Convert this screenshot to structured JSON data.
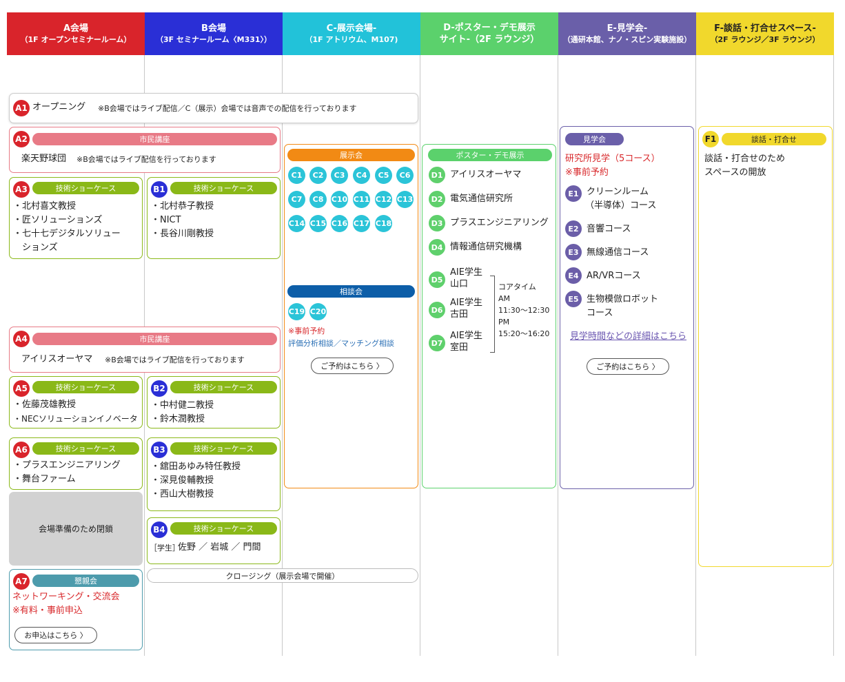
{
  "colors": {
    "A": "#d9242b",
    "B": "#2a2fd6",
    "C": "#22c2d9",
    "D": "#5bd16c",
    "E": "#6a5fa9",
    "F": "#f1d82c",
    "showcase": "#8ab818",
    "lecture": "#e87a86",
    "reception": "#4d9bac",
    "expo": "#f28a14",
    "consult": "#0d5ea8"
  },
  "headers": [
    {
      "line1": "A会場",
      "line2": "（1F オープンセミナールーム）"
    },
    {
      "line1": "B会場",
      "line2": "（3F セミナールーム〈M331〉）"
    },
    {
      "line1": "C-展示会場-",
      "line2": "（1F アトリウム、M107)"
    },
    {
      "line1": "D-ポスター・デモ展示",
      "line2": "サイト-（2F ラウンジ）"
    },
    {
      "line1": "E-見学会-",
      "line2": "（通研本館、ナノ・スピン実験施設）"
    },
    {
      "line1": "F-談話・打合せスペース-",
      "line2": "（2F ラウンジ／3F ラウンジ）"
    }
  ],
  "a1": {
    "badge": "A1",
    "title": "オープニング",
    "note": "※B会場ではライブ配信／C（展示）会場では音声での配信を行っております"
  },
  "a2": {
    "badge": "A2",
    "pill": "市民講座",
    "text": "楽天野球団",
    "note": "※B会場ではライブ配信を行っております"
  },
  "a3": {
    "badge": "A3",
    "pill": "技術ショーケース",
    "items": [
      "・北村喜文教授",
      "・匠ソリューションズ",
      "・七十七デジタルソリュー",
      "　ションズ"
    ]
  },
  "b1": {
    "badge": "B1",
    "pill": "技術ショーケース",
    "items": [
      "・北村恭子教授",
      "・NICT",
      "・長谷川剛教授"
    ]
  },
  "a4": {
    "badge": "A4",
    "pill": "市民講座",
    "text": "アイリスオーヤマ",
    "note": "※B会場ではライブ配信を行っております"
  },
  "a5": {
    "badge": "A5",
    "pill": "技術ショーケース",
    "items": [
      "・佐藤茂雄教授",
      "・NECソリューションイノベータ"
    ]
  },
  "b2": {
    "badge": "B2",
    "pill": "技術ショーケース",
    "items": [
      "・中村健二教授",
      "・鈴木潤教授"
    ]
  },
  "a6": {
    "badge": "A6",
    "pill": "技術ショーケース",
    "items": [
      "・プラスエンジニアリング",
      "・舞台ファーム"
    ]
  },
  "b3": {
    "badge": "B3",
    "pill": "技術ショーケース",
    "items": [
      "・舘田あゆみ特任教授",
      "・深見俊輔教授",
      "・西山大樹教授"
    ]
  },
  "closed": {
    "text": "会場準備のため閉鎖"
  },
  "b4": {
    "badge": "B4",
    "pill": "技術ショーケース",
    "prefix": "［学生］",
    "names": "佐野 ／ 岩城 ／ 門間"
  },
  "closing": {
    "text": "クロージング（展示会場で開催）"
  },
  "a7": {
    "badge": "A7",
    "pill": "懇親会",
    "line1": "ネットワーキング・交流会",
    "line2": "※有料・事前申込",
    "button": "お申込はこちら 〉"
  },
  "c": {
    "expo_pill": "展示会",
    "expo_badges": [
      "C1",
      "C2",
      "C3",
      "C4",
      "C5",
      "C6",
      "C7",
      "C8",
      "C10",
      "C11",
      "C12",
      "C13",
      "C14",
      "C15",
      "C16",
      "C17",
      "C18"
    ],
    "consult_pill": "相談会",
    "consult_badges": [
      "C19",
      "C20"
    ],
    "note": "※事前予約",
    "detail": "評価分析相談／マッチング相談",
    "button": "ご予約はこちら 〉"
  },
  "d": {
    "pill": "ポスター・デモ展示",
    "items": [
      {
        "badge": "D1",
        "text": "アイリスオーヤマ"
      },
      {
        "badge": "D2",
        "text": "電気通信研究所"
      },
      {
        "badge": "D3",
        "text": "プラスエンジニアリング"
      },
      {
        "badge": "D4",
        "text": "情報通信研究機構"
      }
    ],
    "students": [
      {
        "badge": "D5",
        "l1": "AIE学生",
        "l2": "山口"
      },
      {
        "badge": "D6",
        "l1": "AIE学生",
        "l2": "古田"
      },
      {
        "badge": "D7",
        "l1": "AIE学生",
        "l2": "室田"
      }
    ],
    "core": [
      "コアタイム",
      "AM",
      "11:30〜12:30",
      "PM",
      "15:20〜16:20"
    ]
  },
  "e": {
    "pill": "見学会",
    "title": "研究所見学（5コース）",
    "note": "※事前予約",
    "courses": [
      {
        "badge": "E1",
        "l1": "クリーンルーム",
        "l2": "（半導体）コース"
      },
      {
        "badge": "E2",
        "l1": "音響コース",
        "l2": ""
      },
      {
        "badge": "E3",
        "l1": "無線通信コース",
        "l2": ""
      },
      {
        "badge": "E4",
        "l1": "AR/VRコース",
        "l2": ""
      },
      {
        "badge": "E5",
        "l1": "生物模倣ロボット",
        "l2": "コース"
      }
    ],
    "link": "見学時間などの詳細はこちら",
    "button": "ご予約はこちら 〉"
  },
  "f": {
    "badge": "F1",
    "pill": "談話・打合せ",
    "l1": "談話・打合せのため",
    "l2": "スペースの開放"
  }
}
